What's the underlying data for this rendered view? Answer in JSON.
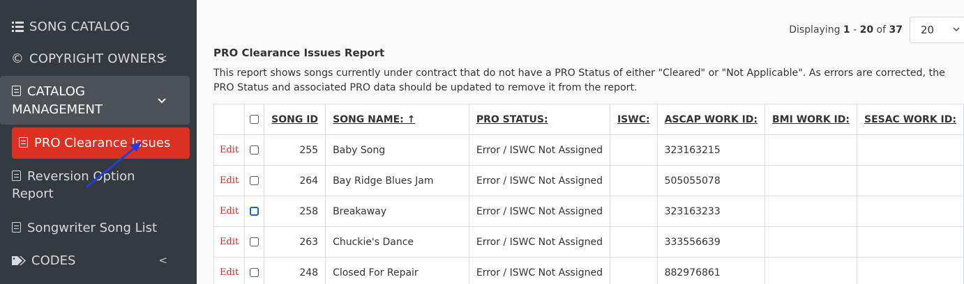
{
  "sidebar": {
    "song_catalog": "SONG CATALOG",
    "copyright_owners": "COPYRIGHT OWNERS",
    "catalog_management": "CATALOG MANAGEMENT",
    "items": [
      {
        "label": "PRO Clearance Issues"
      },
      {
        "label": "Reversion Option Report"
      },
      {
        "label": "Songwriter Song List"
      }
    ],
    "codes": "CODES"
  },
  "pager": {
    "prefix": "Displaying ",
    "from": "1",
    "dash": " - ",
    "to": "20",
    "of": " of ",
    "total": "37",
    "per_page": "20"
  },
  "report": {
    "title": "PRO Clearance Issues Report",
    "description": "This report shows songs currently under contract that do not have a PRO Status of either \"Cleared\" or \"Not Applicable\". As errors are corrected, the PRO Status and associated PRO data should be updated to remove it from the report."
  },
  "table": {
    "headers": [
      "SONG ID",
      "SONG NAME: ↑",
      "PRO STATUS:",
      "ISWC:",
      "ASCAP WORK ID:",
      "BMI WORK ID:",
      "SESAC WORK ID:"
    ],
    "edit_label": "Edit",
    "rows": [
      {
        "song_id": "255",
        "name": "Baby Song",
        "status": "Error / ISWC Not Assigned",
        "iswc": "",
        "ascap": "323163215",
        "bmi": "",
        "sesac": ""
      },
      {
        "song_id": "264",
        "name": "Bay Ridge Blues Jam",
        "status": "Error / ISWC Not Assigned",
        "iswc": "",
        "ascap": "505055078",
        "bmi": "",
        "sesac": ""
      },
      {
        "song_id": "258",
        "name": "Breakaway",
        "status": "Error / ISWC Not Assigned",
        "iswc": "",
        "ascap": "323163233",
        "bmi": "",
        "sesac": ""
      },
      {
        "song_id": "263",
        "name": "Chuckie's Dance",
        "status": "Error / ISWC Not Assigned",
        "iswc": "",
        "ascap": "333556639",
        "bmi": "",
        "sesac": ""
      },
      {
        "song_id": "248",
        "name": "Closed For Repair",
        "status": "Error / ISWC Not Assigned",
        "iswc": "",
        "ascap": "882976861",
        "bmi": "",
        "sesac": ""
      }
    ]
  },
  "colors": {
    "sidebar_bg": "#343a40",
    "active_item": "#dc3022",
    "edit_link": "#cc2b21",
    "annotation_arrow": "#1f3fd8"
  },
  "icons": [
    "list-icon",
    "copyright-icon",
    "document-icon",
    "chevron-left-icon",
    "chevron-down-icon",
    "tag-icon",
    "sort-up-arrow-icon"
  ]
}
